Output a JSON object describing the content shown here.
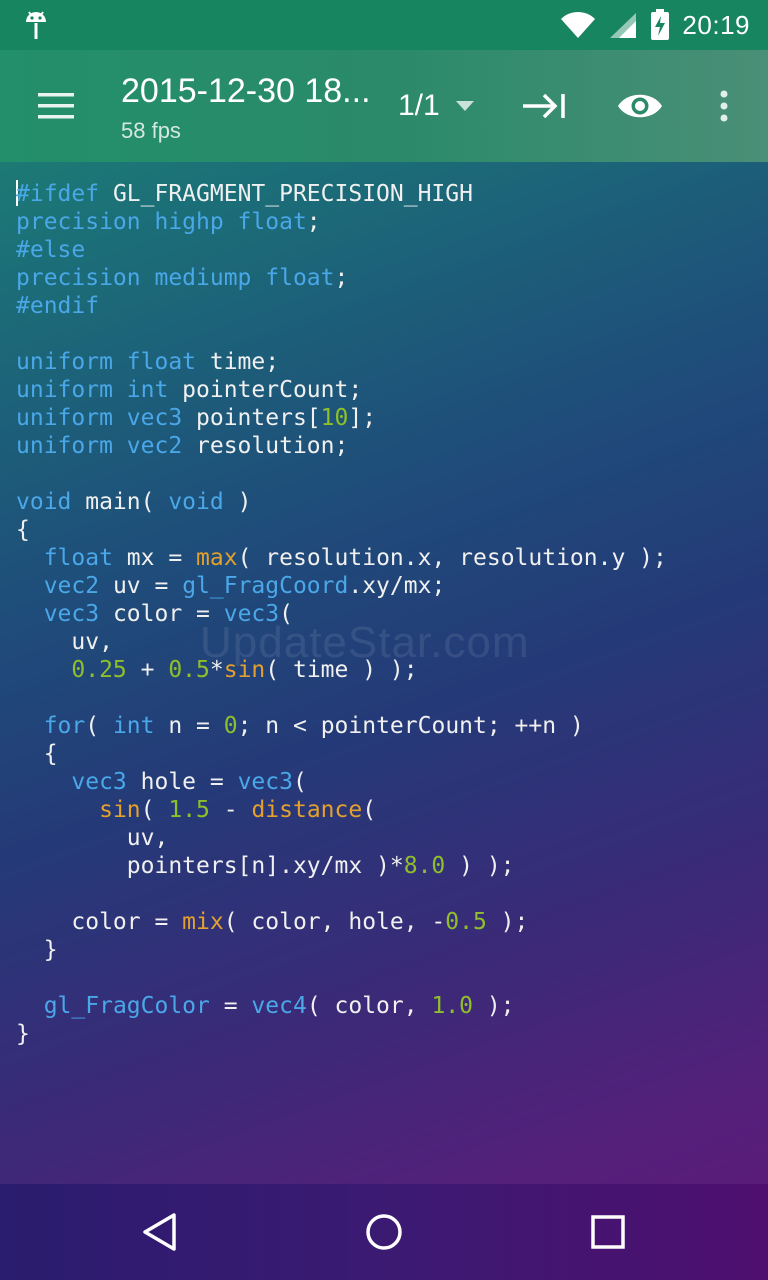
{
  "status_bar": {
    "time": "20:19",
    "icons": [
      "android-debug-icon",
      "wifi-icon",
      "cell-signal-icon",
      "battery-charging-icon"
    ]
  },
  "app_bar": {
    "title": "2015-12-30 18...",
    "subtitle": "58 fps",
    "pager": "1/1",
    "icons": [
      "menu-icon",
      "dropdown-arrow-icon",
      "tab-indent-icon",
      "eye-icon",
      "overflow-icon"
    ]
  },
  "code_lines": [
    [
      {
        "t": "#ifdef",
        "c": "k"
      },
      {
        "t": " GL_FRAGMENT_PRECISION_HIGH",
        "c": ""
      }
    ],
    [
      {
        "t": "precision highp float",
        "c": "k"
      },
      {
        "t": ";",
        "c": ""
      }
    ],
    [
      {
        "t": "#else",
        "c": "k"
      }
    ],
    [
      {
        "t": "precision mediump float",
        "c": "k"
      },
      {
        "t": ";",
        "c": ""
      }
    ],
    [
      {
        "t": "#endif",
        "c": "k"
      }
    ],
    [],
    [
      {
        "t": "uniform float",
        "c": "k"
      },
      {
        "t": " time;",
        "c": ""
      }
    ],
    [
      {
        "t": "uniform int",
        "c": "k"
      },
      {
        "t": " pointerCount;",
        "c": ""
      }
    ],
    [
      {
        "t": "uniform vec3",
        "c": "k"
      },
      {
        "t": " pointers[",
        "c": ""
      },
      {
        "t": "10",
        "c": "n"
      },
      {
        "t": "];",
        "c": ""
      }
    ],
    [
      {
        "t": "uniform vec2",
        "c": "k"
      },
      {
        "t": " resolution;",
        "c": ""
      }
    ],
    [],
    [
      {
        "t": "void",
        "c": "k"
      },
      {
        "t": " main( ",
        "c": ""
      },
      {
        "t": "void",
        "c": "k"
      },
      {
        "t": " )",
        "c": ""
      }
    ],
    [
      {
        "t": "{",
        "c": ""
      }
    ],
    [
      {
        "t": "  ",
        "c": ""
      },
      {
        "t": "float",
        "c": "k"
      },
      {
        "t": " mx = ",
        "c": ""
      },
      {
        "t": "max",
        "c": "f"
      },
      {
        "t": "( resolution.x, resolution.y );",
        "c": ""
      }
    ],
    [
      {
        "t": "  ",
        "c": ""
      },
      {
        "t": "vec2",
        "c": "k"
      },
      {
        "t": " uv = ",
        "c": ""
      },
      {
        "t": "gl_FragCoord",
        "c": "k"
      },
      {
        "t": ".xy/mx;",
        "c": ""
      }
    ],
    [
      {
        "t": "  ",
        "c": ""
      },
      {
        "t": "vec3",
        "c": "k"
      },
      {
        "t": " color = ",
        "c": ""
      },
      {
        "t": "vec3",
        "c": "k"
      },
      {
        "t": "(",
        "c": ""
      }
    ],
    [
      {
        "t": "    uv,",
        "c": ""
      }
    ],
    [
      {
        "t": "    ",
        "c": ""
      },
      {
        "t": "0.25",
        "c": "n"
      },
      {
        "t": " + ",
        "c": ""
      },
      {
        "t": "0.5",
        "c": "n"
      },
      {
        "t": "*",
        "c": ""
      },
      {
        "t": "sin",
        "c": "f"
      },
      {
        "t": "( time ) );",
        "c": ""
      }
    ],
    [],
    [
      {
        "t": "  ",
        "c": ""
      },
      {
        "t": "for",
        "c": "k"
      },
      {
        "t": "( ",
        "c": ""
      },
      {
        "t": "int",
        "c": "k"
      },
      {
        "t": " n = ",
        "c": ""
      },
      {
        "t": "0",
        "c": "n"
      },
      {
        "t": "; n < pointerCount; ++n )",
        "c": ""
      }
    ],
    [
      {
        "t": "  {",
        "c": ""
      }
    ],
    [
      {
        "t": "    ",
        "c": ""
      },
      {
        "t": "vec3",
        "c": "k"
      },
      {
        "t": " hole = ",
        "c": ""
      },
      {
        "t": "vec3",
        "c": "k"
      },
      {
        "t": "(",
        "c": ""
      }
    ],
    [
      {
        "t": "      ",
        "c": ""
      },
      {
        "t": "sin",
        "c": "f"
      },
      {
        "t": "( ",
        "c": ""
      },
      {
        "t": "1.5",
        "c": "n"
      },
      {
        "t": " - ",
        "c": ""
      },
      {
        "t": "distance",
        "c": "f"
      },
      {
        "t": "(",
        "c": ""
      }
    ],
    [
      {
        "t": "        uv,",
        "c": ""
      }
    ],
    [
      {
        "t": "        pointers[n].xy/mx )*",
        "c": ""
      },
      {
        "t": "8.0",
        "c": "n"
      },
      {
        "t": " ) );",
        "c": ""
      }
    ],
    [],
    [
      {
        "t": "    color = ",
        "c": ""
      },
      {
        "t": "mix",
        "c": "f"
      },
      {
        "t": "( color, hole, -",
        "c": ""
      },
      {
        "t": "0.5",
        "c": "n"
      },
      {
        "t": " );",
        "c": ""
      }
    ],
    [
      {
        "t": "  }",
        "c": ""
      }
    ],
    [],
    [
      {
        "t": "  ",
        "c": ""
      },
      {
        "t": "gl_FragColor",
        "c": "k"
      },
      {
        "t": " = ",
        "c": ""
      },
      {
        "t": "vec4",
        "c": "k"
      },
      {
        "t": "( color, ",
        "c": ""
      },
      {
        "t": "1.0",
        "c": "n"
      },
      {
        "t": " );",
        "c": ""
      }
    ],
    [
      {
        "t": "}",
        "c": ""
      }
    ]
  ],
  "watermark": "UpdateStar.com",
  "nav_bar": {
    "icons": [
      "back-icon",
      "home-icon",
      "recents-icon"
    ]
  },
  "colors": {
    "keyword": "#4aa7e8",
    "number": "#8fbf2a",
    "function": "#e3a02c",
    "status_bar": "#17855f"
  }
}
